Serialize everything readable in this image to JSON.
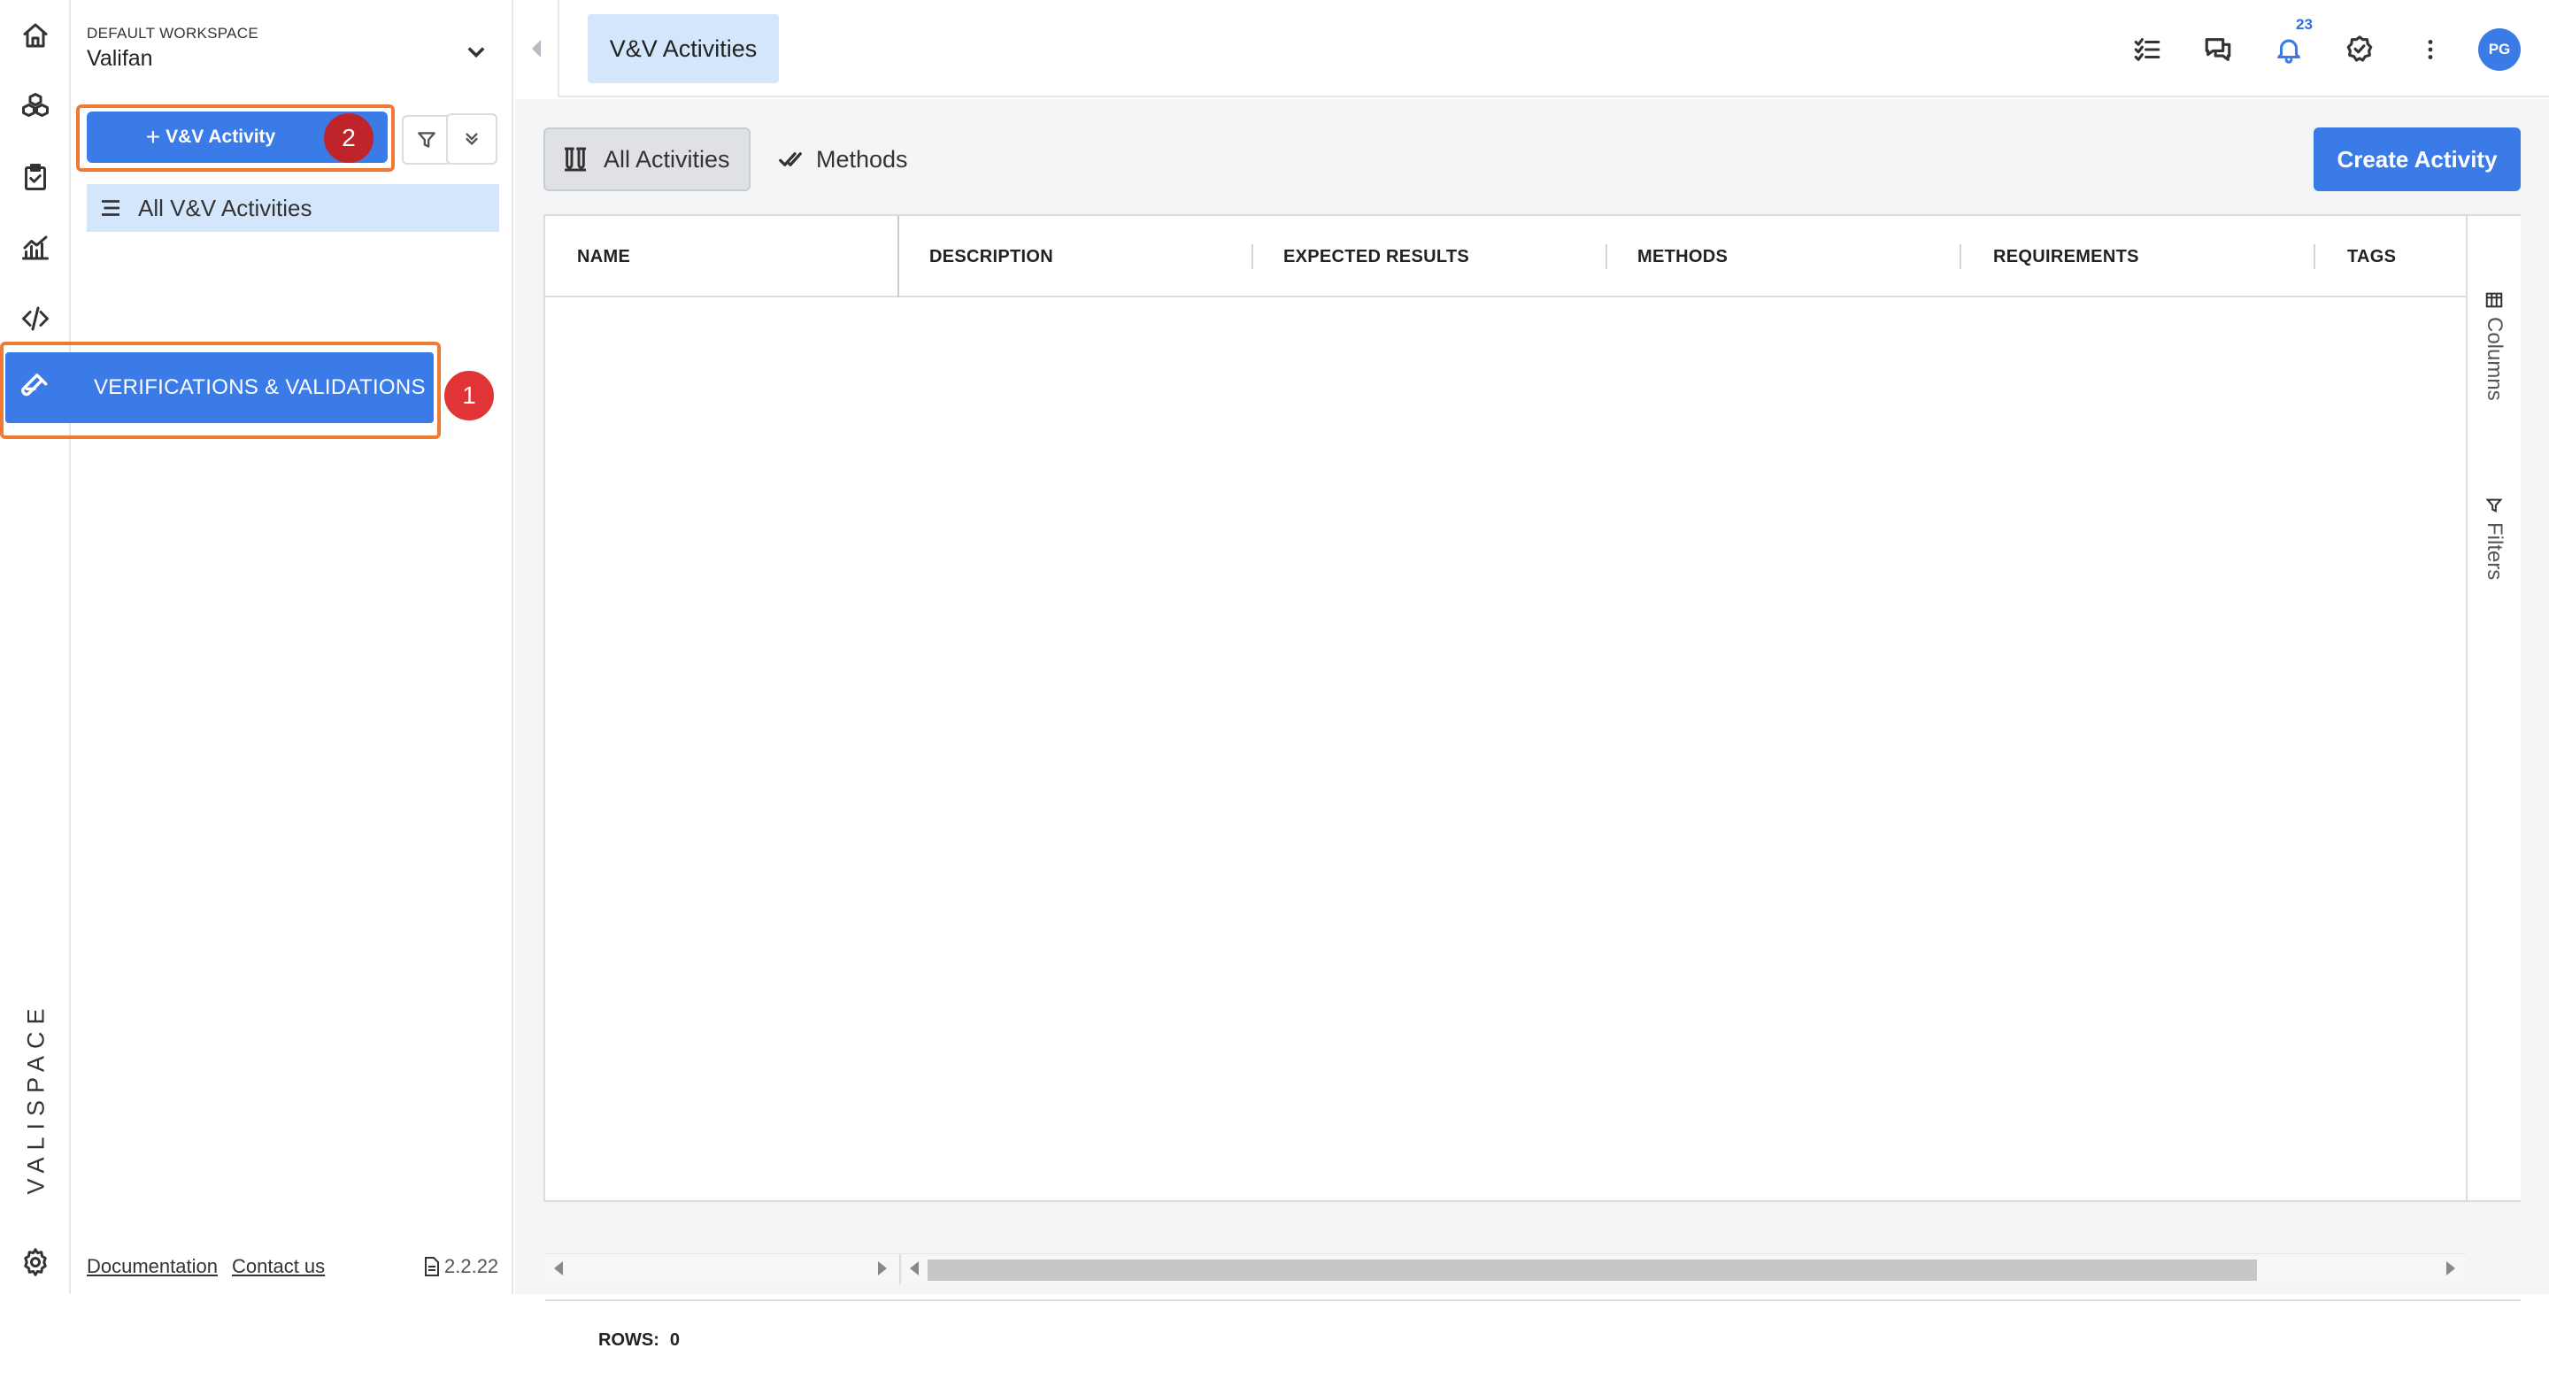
{
  "workspace": {
    "label": "DEFAULT WORKSPACE",
    "name": "Valifan"
  },
  "sidebar": {
    "add_button_label": "V&V Activity",
    "add_button_plus": "+",
    "callout_1": "1",
    "callout_2": "2",
    "list_item": "All V&V Activities",
    "active_nav": "VERIFICATIONS & VALIDATIONS",
    "footer": {
      "documentation": "Documentation",
      "contact": "Contact us",
      "version": "2.2.22"
    }
  },
  "rail": {
    "icons": [
      "home-icon",
      "modules-icon",
      "clipboard-check-icon",
      "analytics-icon",
      "code-icon",
      "settings-icon"
    ],
    "logo": "VALISPACE"
  },
  "topbar": {
    "tab_label": "V&V Activities",
    "notification_count": "23",
    "avatar_initials": "PG",
    "icons": [
      "checklist-icon",
      "chat-icon",
      "bell-icon",
      "check-badge-icon",
      "more-vert-icon"
    ]
  },
  "main": {
    "view_tabs": [
      "All Activities",
      "Methods"
    ],
    "create_button": "Create Activity",
    "columns": [
      "NAME",
      "DESCRIPTION",
      "EXPECTED RESULTS",
      "METHODS",
      "REQUIREMENTS",
      "TAGS"
    ],
    "side_tabs": [
      "Columns",
      "Filters"
    ],
    "rows_label": "ROWS:",
    "rows_value": "0"
  },
  "colors": {
    "accent": "#3b7be8",
    "highlight": "#f07a32",
    "callout": "#e03436",
    "selected_bg": "#d4e6fb"
  }
}
